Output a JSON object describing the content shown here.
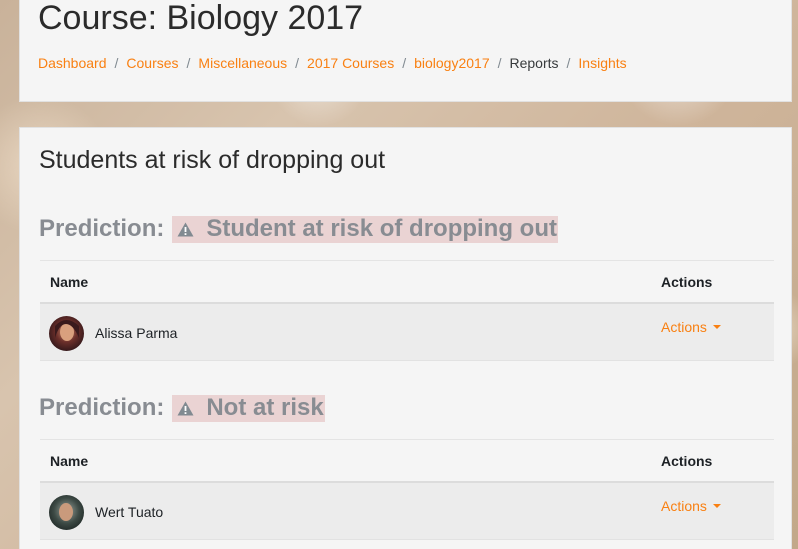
{
  "header": {
    "title": "Course: Biology 2017",
    "breadcrumb": [
      {
        "label": "Dashboard",
        "link": true
      },
      {
        "label": "Courses",
        "link": true
      },
      {
        "label": "Miscellaneous",
        "link": true
      },
      {
        "label": "2017 Courses",
        "link": true
      },
      {
        "label": "biology2017",
        "link": true
      },
      {
        "label": "Reports",
        "link": false
      },
      {
        "label": "Insights",
        "link": true
      }
    ],
    "separator": "/"
  },
  "main": {
    "title": "Students at risk of dropping out",
    "predictions": [
      {
        "label": "Prediction:",
        "value": "Student at risk of dropping out",
        "icon": "warning-icon",
        "columns": {
          "name": "Name",
          "actions": "Actions"
        },
        "rows": [
          {
            "name": "Alissa Parma",
            "actions_label": "Actions"
          }
        ]
      },
      {
        "label": "Prediction:",
        "value": "Not at risk",
        "icon": "warning-icon",
        "columns": {
          "name": "Name",
          "actions": "Actions"
        },
        "rows": [
          {
            "name": "Wert Tuato",
            "actions_label": "Actions"
          }
        ]
      }
    ]
  },
  "colors": {
    "link": "#f98012",
    "highlight": "#ead3d3",
    "prediction_text": "#888c92"
  }
}
